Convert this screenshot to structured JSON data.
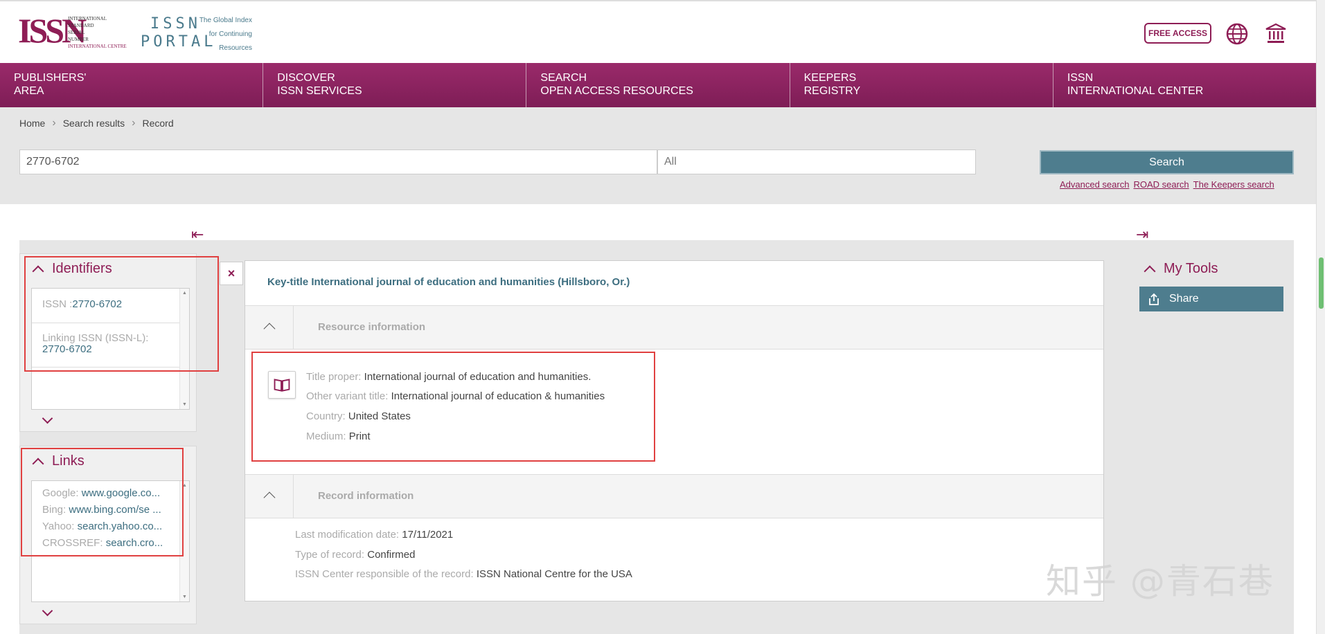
{
  "header": {
    "logo_text": "ISSN",
    "logo_small": [
      "INTERNATIONAL",
      "STANDARD",
      "SERIAL",
      "NUMBER",
      "INTERNATIONAL CENTRE"
    ],
    "portal_line1": "ISSN",
    "portal_line2": "PORTAL",
    "tagline": [
      "The Global Index",
      "for Continuing",
      "Resources"
    ],
    "free_access": "FREE ACCESS",
    "icons": [
      "globe-icon",
      "institution-icon"
    ],
    "brand_color": "#8e1d55"
  },
  "nav": [
    {
      "l1": "PUBLISHERS'",
      "l2": "AREA"
    },
    {
      "l1": "DISCOVER",
      "l2": "ISSN SERVICES"
    },
    {
      "l1": "SEARCH",
      "l2": "OPEN ACCESS RESOURCES"
    },
    {
      "l1": "KEEPERS",
      "l2": "REGISTRY"
    },
    {
      "l1": "ISSN",
      "l2": "INTERNATIONAL CENTER"
    }
  ],
  "breadcrumb": [
    "Home",
    "Search results",
    "Record"
  ],
  "search": {
    "value": "2770-6702",
    "scope": "All",
    "button": "Search",
    "links": [
      "Advanced search",
      "ROAD search",
      "The Keepers search"
    ]
  },
  "identifiers": {
    "title": "Identifiers",
    "issn_label": "ISSN :",
    "issn_value": "2770-6702",
    "linking_label": "Linking ISSN (ISSN-L):",
    "linking_value": "2770-6702"
  },
  "links_panel": {
    "title": "Links",
    "items": [
      {
        "label": "Google:",
        "value": "www.google.co..."
      },
      {
        "label": "Bing:",
        "value": "www.bing.com/se ..."
      },
      {
        "label": "Yahoo:",
        "value": "search.yahoo.co..."
      },
      {
        "label": "CROSSREF:",
        "value": "search.cro..."
      }
    ]
  },
  "close_label": "×",
  "record": {
    "key_title": "Key-title International journal of education and humanities (Hillsboro, Or.)",
    "resource_header": "Resource information",
    "resource": [
      {
        "label": "Title proper:",
        "value": "International journal of education and humanities."
      },
      {
        "label": "Other variant title:",
        "value": "International journal of education & humanities"
      },
      {
        "label": "Country:",
        "value": "United States"
      },
      {
        "label": "Medium:",
        "value": "Print"
      }
    ],
    "record_header": "Record information",
    "record_info": [
      {
        "label": "Last modification date:",
        "value": "17/11/2021"
      },
      {
        "label": "Type of record:",
        "value": "Confirmed"
      },
      {
        "label": "ISSN Center responsible of the record:",
        "value": "ISSN National Centre for the USA"
      }
    ]
  },
  "tools": {
    "title": "My Tools",
    "share": "Share"
  },
  "watermark": "知乎 @青石巷"
}
